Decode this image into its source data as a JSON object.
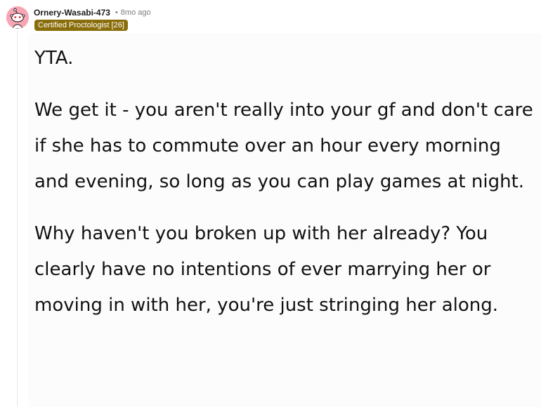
{
  "comment": {
    "author": "Ornery-Wasabi-473",
    "separator": "•",
    "timestamp": "8mo ago",
    "flair": {
      "text": "Certified Proctologist [26]",
      "bg_color": "#8a6d0b",
      "text_color": "#ffffff"
    },
    "avatar": {
      "icon": "snoo-avatar-icon",
      "bg_color": "#f7a6b3"
    },
    "paragraphs": [
      "YTA.",
      "We get it - you aren't really into your gf and don't care if she has to commute over an hour every morning and evening, so long as you can play games at night.",
      "Why haven't you broken up with her already? You clearly have no intentions of ever marrying her or moving in with her, you're just stringing her along."
    ]
  }
}
